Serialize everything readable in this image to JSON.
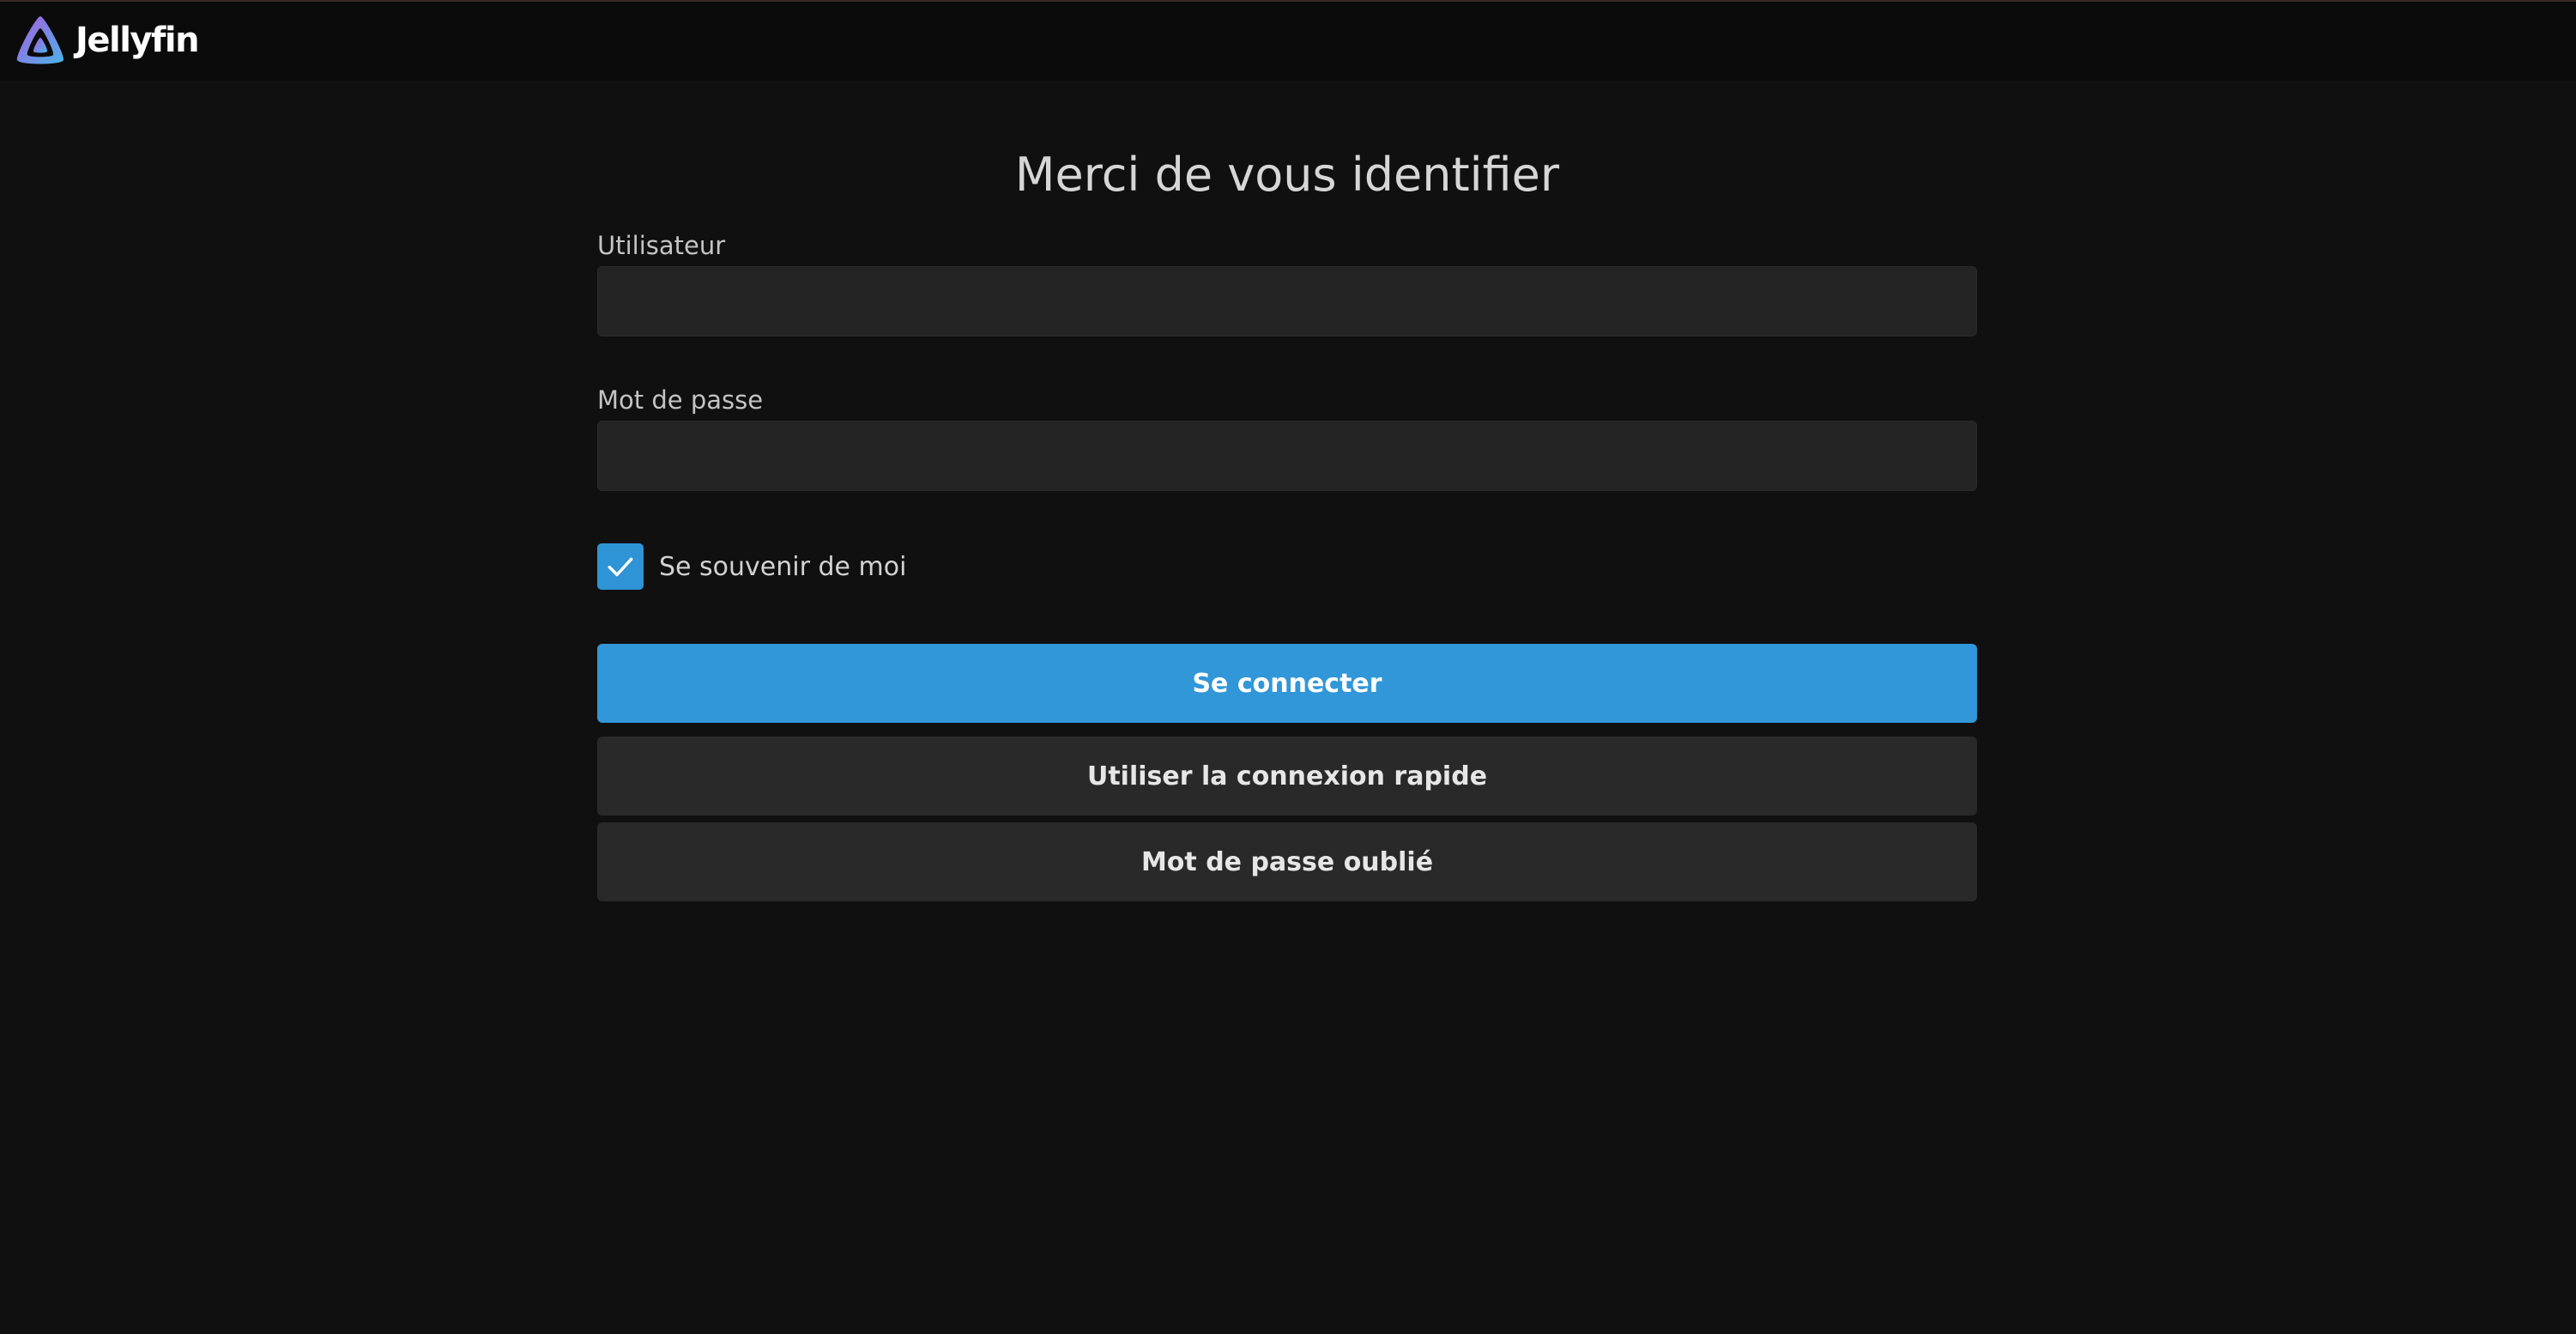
{
  "header": {
    "app_name": "Jellyfin",
    "logo_icon": "jellyfin-triangle-icon"
  },
  "login": {
    "title": "Merci de vous identifier",
    "username_label": "Utilisateur",
    "username_value": "",
    "password_label": "Mot de passe",
    "password_value": "",
    "remember_label": "Se souvenir de moi",
    "remember_checked": true,
    "sign_in_button": "Se connecter",
    "quick_connect_button": "Utiliser la connexion rapide",
    "forgot_password_button": "Mot de passe oublié"
  },
  "colors": {
    "accent": "#3197d8",
    "background": "#101010",
    "header_background": "#0b0b0b",
    "input_background": "#242424",
    "secondary_button": "#292929"
  }
}
